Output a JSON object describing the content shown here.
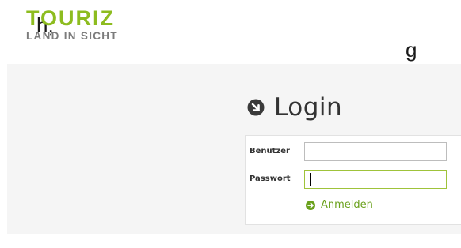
{
  "partial_top_text": {
    "left": "h, ",
    "right": "g"
  },
  "logo": {
    "main": "TOURIZ",
    "sub": "LAND IN SICHT",
    "main_color": "#8dbc1f",
    "sub_color": "#7c7c7c"
  },
  "login": {
    "title": "Login",
    "title_icon": "circle-arrow-down-right-icon",
    "username_label": "Benutzer",
    "username_value": "",
    "password_label": "Passwort",
    "password_value": "",
    "submit_icon": "circle-arrow-right-icon",
    "submit_label": "Anmelden",
    "accent_color": "#6aa11c"
  }
}
